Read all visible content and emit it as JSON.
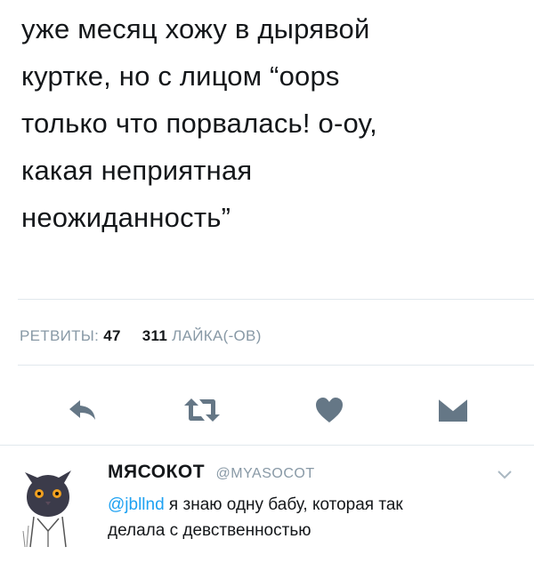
{
  "tweet": {
    "lines": [
      "уже месяц хожу в дырявой",
      "куртке, но с лицом “oops",
      "только что порвалась! о-оу,",
      "какая неприятная",
      "неожиданность”"
    ]
  },
  "stats": {
    "retweets_label": "РЕТВИТЫ:",
    "retweets_count": "47",
    "likes_count": "311",
    "likes_label": "ЛАЙКА(-ОВ)"
  },
  "actions": {
    "icons": [
      "reply-icon",
      "retweet-icon",
      "like-icon",
      "direct-message-icon"
    ],
    "color": "#657786"
  },
  "reply": {
    "display_name": "МЯСОКОТ",
    "handle": "@MYASOCOT",
    "mention": "@jbllnd",
    "text_line1": " я знаю одну бабу, которая так",
    "text_line2": "делала с девственностью"
  },
  "colors": {
    "text": "#14171a",
    "muted": "#8899a6",
    "link": "#1da1f2",
    "divider": "#e1e8ed"
  }
}
